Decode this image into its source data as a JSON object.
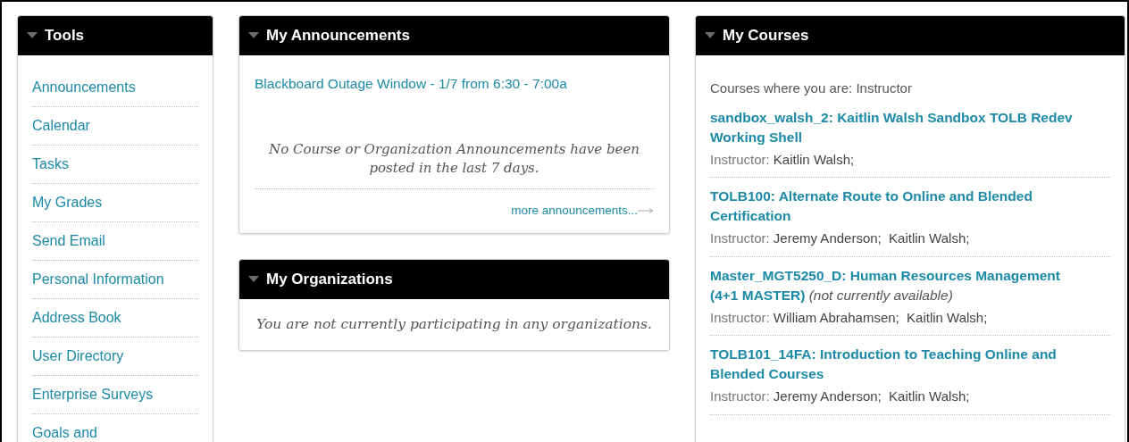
{
  "tools": {
    "title": "Tools",
    "expanded": true,
    "items": [
      "Announcements",
      "Calendar",
      "Tasks",
      "My Grades",
      "Send Email",
      "Personal Information",
      "Address Book",
      "User Directory",
      "Enterprise Surveys",
      "Goals and"
    ]
  },
  "announcements": {
    "title": "My Announcements",
    "expanded": true,
    "items": [
      "Blackboard Outage Window - 1/7 from 6:30 - 7:00a"
    ],
    "empty_message": "No Course or Organization Announcements have been posted in the last 7 days.",
    "more_link": "more announcements..."
  },
  "organizations": {
    "title": "My Organizations",
    "expanded": true,
    "empty_message": "You are not currently participating in any organizations."
  },
  "courses": {
    "title": "My Courses",
    "expanded": true,
    "role_line": "Courses where you are: Instructor",
    "items": [
      {
        "title": "sandbox_walsh_2: Kaitlin Walsh Sandbox TOLB Redev Working Shell",
        "instructor_label": "Instructor:",
        "instructors": "Kaitlin Walsh;"
      },
      {
        "title": "TOLB100: Alternate Route to Online and Blended Certification",
        "instructor_label": "Instructor:",
        "instructors": "Jeremy Anderson;  Kaitlin Walsh;"
      },
      {
        "title": "Master_MGT5250_D: Human Resources Management (4+1 MASTER)",
        "note": "(not currently available)",
        "instructor_label": "Instructor:",
        "instructors": "William Abrahamsen;  Kaitlin Walsh;"
      },
      {
        "title": "TOLB101_14FA: Introduction to Teaching Online and Blended Courses",
        "instructor_label": "Instructor:",
        "instructors": "Jeremy Anderson;  Kaitlin Walsh;"
      }
    ]
  }
}
